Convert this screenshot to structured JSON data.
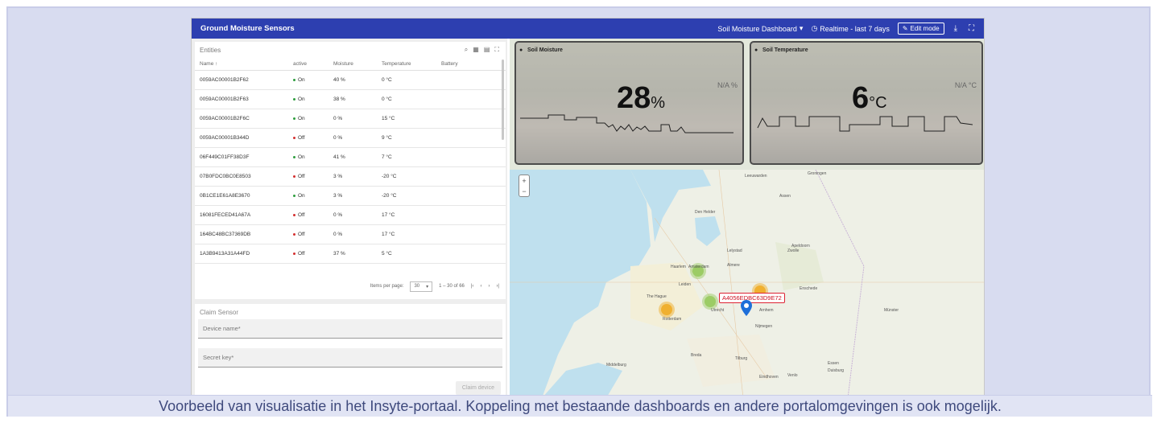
{
  "app": {
    "title": "Ground Moisture Sensors",
    "dashboard_selector": "Soil Moisture Dashboard",
    "timewindow": "Realtime - last 7 days",
    "edit_mode": "Edit mode"
  },
  "entities": {
    "title": "Entities",
    "columns": [
      "Name",
      "active",
      "Moisture",
      "Temperature",
      "Battery"
    ],
    "rows": [
      {
        "name": "0059AC00001B2F62",
        "active": "On",
        "moisture": "40 %",
        "temperature": "0 °C"
      },
      {
        "name": "0059AC00001B2F63",
        "active": "On",
        "moisture": "38 %",
        "temperature": "0 °C"
      },
      {
        "name": "0059AC00001B2F6C",
        "active": "On",
        "moisture": "0 %",
        "temperature": "15 °C"
      },
      {
        "name": "0059AC00001B344D",
        "active": "Off",
        "moisture": "0 %",
        "temperature": "9 °C"
      },
      {
        "name": "06F449C01FF38D3F",
        "active": "On",
        "moisture": "41 %",
        "temperature": "7 °C"
      },
      {
        "name": "07B0FDC0BC0E8503",
        "active": "Off",
        "moisture": "3 %",
        "temperature": "-20 °C"
      },
      {
        "name": "0B1CE1E61A8E3670",
        "active": "On",
        "moisture": "3 %",
        "temperature": "-20 °C"
      },
      {
        "name": "16081FECED41A67A",
        "active": "Off",
        "moisture": "0 %",
        "temperature": "17 °C"
      },
      {
        "name": "164BC48BC37369DB",
        "active": "Off",
        "moisture": "0 %",
        "temperature": "17 °C"
      },
      {
        "name": "1A3B9413A31A44FD",
        "active": "Off",
        "moisture": "37 %",
        "temperature": "5 °C"
      }
    ],
    "pager": {
      "items_per_page_label": "Items per page:",
      "items_per_page": "30",
      "range": "1 – 30 of 66"
    },
    "colors": {
      "on": "#2e9e3e",
      "off": "#d32f2f"
    }
  },
  "claim": {
    "title": "Claim Sensor",
    "device_name_placeholder": "Device name*",
    "secret_key_placeholder": "Secret key*",
    "button": "Claim device"
  },
  "cards": [
    {
      "title": "Soil Moisture",
      "value": "28",
      "unit": "%",
      "secondary": "N/A %"
    },
    {
      "title": "Soil Temperature",
      "value": "6",
      "unit": "°C",
      "secondary": "N/A °C"
    }
  ],
  "map": {
    "marker_label": "A4056EDBC63D9E72",
    "places": [
      "Leeuwarden",
      "Groningen",
      "Assen",
      "Den Helder",
      "Zwolle",
      "Haarlem",
      "Amsterdam",
      "Almere",
      "Leiden",
      "The Hague",
      "Rotterdam",
      "Utrecht",
      "Arnhem",
      "Nijmegen",
      "Enschede",
      "Eindhoven",
      "Tilburg",
      "Breda",
      "Apeldoorn",
      "Lelystad",
      "Middelburg",
      "Venlo",
      "Münster",
      "Duisburg",
      "Essen"
    ]
  },
  "caption": "Voorbeeld van visualisatie in het Insyte-portaal. Koppeling met bestaande dashboards en andere portalomgevingen is ook mogelijk."
}
